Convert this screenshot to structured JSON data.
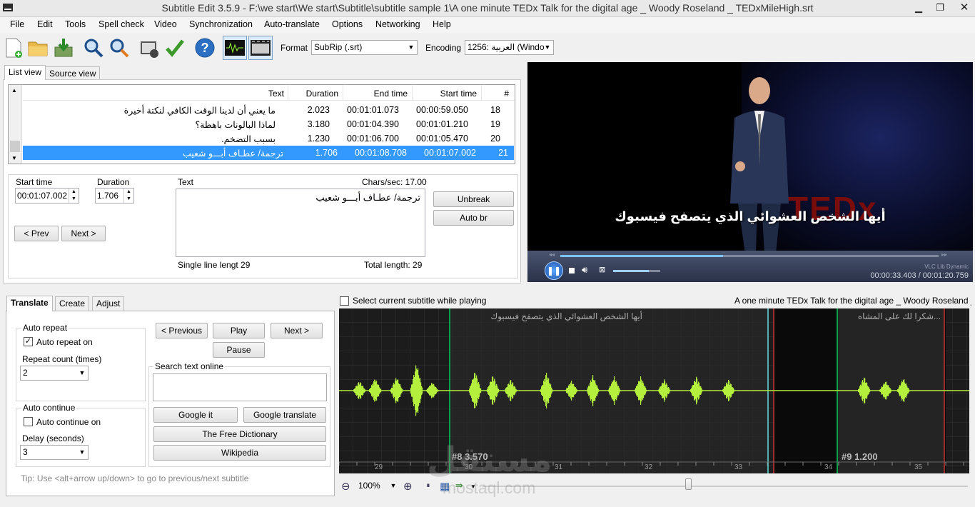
{
  "window": {
    "title": "Subtitle Edit 3.5.9 - F:\\we start\\We start\\Subtitle\\subtitle sample 1\\A one minute TEDx Talk for the digital age _ Woody Roseland _ TEDxMileHigh.srt"
  },
  "menu": [
    "File",
    "Edit",
    "Tools",
    "Spell check",
    "Video",
    "Synchronization",
    "Auto-translate",
    "Options",
    "Networking",
    "Help"
  ],
  "toolbar": {
    "format_label": "Format",
    "format_value": "SubRip (.srt)",
    "encoding_label": "Encoding",
    "encoding_value": "1256: العربية (Windo"
  },
  "list_tabs": [
    "List view",
    "Source view"
  ],
  "table": {
    "headers": {
      "text": "Text",
      "duration": "Duration",
      "end": "End time",
      "start": "Start time",
      "num": "#"
    },
    "rows": [
      {
        "text": "ما يعني أن لدينا الوقت الكافي لنكتة أخيرة",
        "duration": "2.023",
        "end": "00:01:01.073",
        "start": "00:00:59.050",
        "num": "18"
      },
      {
        "text": "لماذا البالونات باهظة؟",
        "duration": "3.180",
        "end": "00:01:04.390",
        "start": "00:01:01.210",
        "num": "19"
      },
      {
        "text": "بسبب التضخم.",
        "duration": "1.230",
        "end": "00:01:06.700",
        "start": "00:01:05.470",
        "num": "20"
      },
      {
        "text": "ترجمة/ عطـاف أبـــو شعيب",
        "duration": "1.706",
        "end": "00:01:08.708",
        "start": "00:01:07.002",
        "num": "21"
      }
    ]
  },
  "editor": {
    "start_label": "Start time",
    "start_value": "00:01:07.002",
    "duration_label": "Duration",
    "duration_value": "1.706",
    "text_label": "Text",
    "chars_sec": "Chars/sec: 17.00",
    "text_value": "ترجمة/ عطـاف أبـــو شعيب",
    "unbreak": "Unbreak",
    "auto_br": "Auto br",
    "prev": "< Prev",
    "next": "Next >",
    "single_line": "Single line lengt 29",
    "total_length": "Total length: 29"
  },
  "video": {
    "subtitle": "أيها الشخص العشوائي الذي يتصفح فيسبوك",
    "lib": "VLC Lib Dynamic",
    "time": "00:00:33.403 / 00:01:20.759",
    "watermark": "TEDx",
    "progress": 0.43,
    "volume": 0.75
  },
  "bottom_tabs": [
    "Translate",
    "Create",
    "Adjust"
  ],
  "translate": {
    "auto_repeat_group": "Auto repeat",
    "auto_repeat_on": "Auto repeat on",
    "repeat_count_label": "Repeat count (times)",
    "repeat_count": "2",
    "auto_continue_group": "Auto continue",
    "auto_continue_on": "Auto continue on",
    "delay_label": "Delay (seconds)",
    "delay": "3",
    "previous": "< Previous",
    "play": "Play",
    "next": "Next >",
    "pause": "Pause",
    "search_online": "Search text online",
    "google_it": "Google it",
    "google_translate": "Google translate",
    "free_dictionary": "The Free Dictionary",
    "wikipedia": "Wikipedia",
    "tip": "Tip: Use <alt+arrow up/down> to go to previous/next subtitle"
  },
  "waveform": {
    "select_while_playing": "Select current subtitle while playing",
    "file_label": "A one minute TEDx Talk for the digital age _ Woody Roseland _",
    "sub_text_1": "أيها الشخص العشوائي الذي يتصفح فيسبوك",
    "sub_text_2": "...شكرا لك على المشاه",
    "label_8": "#8  3.570",
    "label_9": "#9  1.200",
    "ticks": [
      "29",
      "30",
      "31",
      "32",
      "33",
      "34",
      "35"
    ],
    "zoom": "100%",
    "watermark_ar": "مستقل",
    "watermark_en": "mostaql.com"
  }
}
